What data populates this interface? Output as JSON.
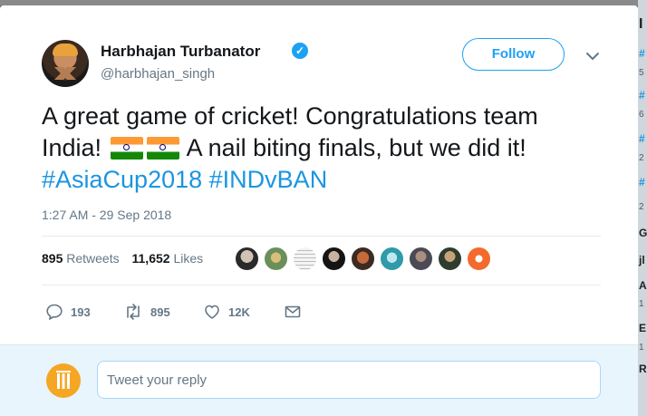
{
  "tweet": {
    "author_name": "Harbhajan Turbanator",
    "author_handle": "@harbhajan_singh",
    "follow_label": "Follow",
    "text_part1": "A great game of cricket! Congratulations team India!",
    "text_part2": "A nail biting finals, but we did it!",
    "hashtag1": "#AsiaCup2018",
    "hashtag2": "#INDvBAN",
    "timestamp": "1:27 AM - 29 Sep 2018",
    "retweets_count": "895",
    "retweets_label": "Retweets",
    "likes_count": "11,652",
    "likes_label": "Likes",
    "reply_count": "193",
    "retweet_action_count": "895",
    "like_action_count": "12K"
  },
  "reply": {
    "placeholder": "Tweet your reply"
  },
  "sidebar_glyphs": [
    "I",
    "#",
    "5",
    "#",
    "6",
    "#",
    "2",
    "#",
    "2",
    "G",
    "jl",
    "A",
    "1",
    "E",
    "1",
    "R"
  ],
  "colors": {
    "accent": "#1da1f2",
    "hashtag": "#1b95e0",
    "text": "#14171a",
    "muted": "#657786",
    "reply_bg": "#e8f5fd"
  },
  "icons": {
    "verified": "verified-badge-icon",
    "caret": "chevron-down-icon",
    "reply": "reply-icon",
    "retweet": "retweet-icon",
    "like": "heart-icon",
    "dm": "envelope-icon",
    "flag": "india-flag-emoji"
  }
}
